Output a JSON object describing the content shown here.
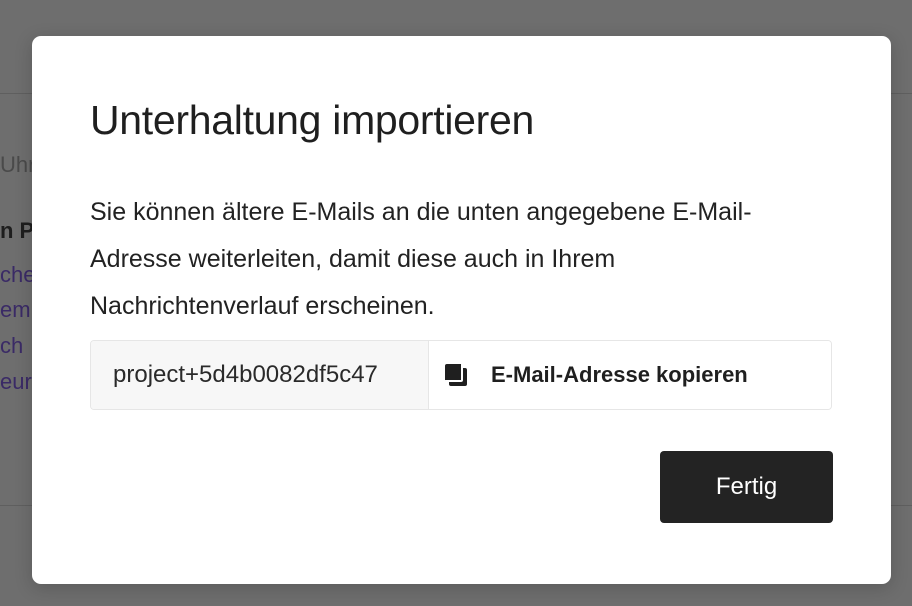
{
  "background": {
    "fragments": {
      "greeting": "Uhr",
      "bold": "n Pr",
      "links": [
        "che",
        "em",
        "ch",
        "eur"
      ]
    }
  },
  "dialog": {
    "title": "Unterhaltung importieren",
    "description": "Sie können ältere E-Mails an die unten angegebene E-Mail-Adresse weiterleiten, damit diese auch in Ihrem Nachrichtenverlauf erscheinen.",
    "email_value": "project+5d4b0082df5c47",
    "copy_icon": "copy-icon",
    "copy_label": "E-Mail-Adresse kopieren",
    "done_label": "Fertig"
  },
  "colors": {
    "backdrop": "#6e6e6e",
    "modal_bg": "#ffffff",
    "primary_button": "#232323",
    "link_text": "#3a2a66"
  }
}
